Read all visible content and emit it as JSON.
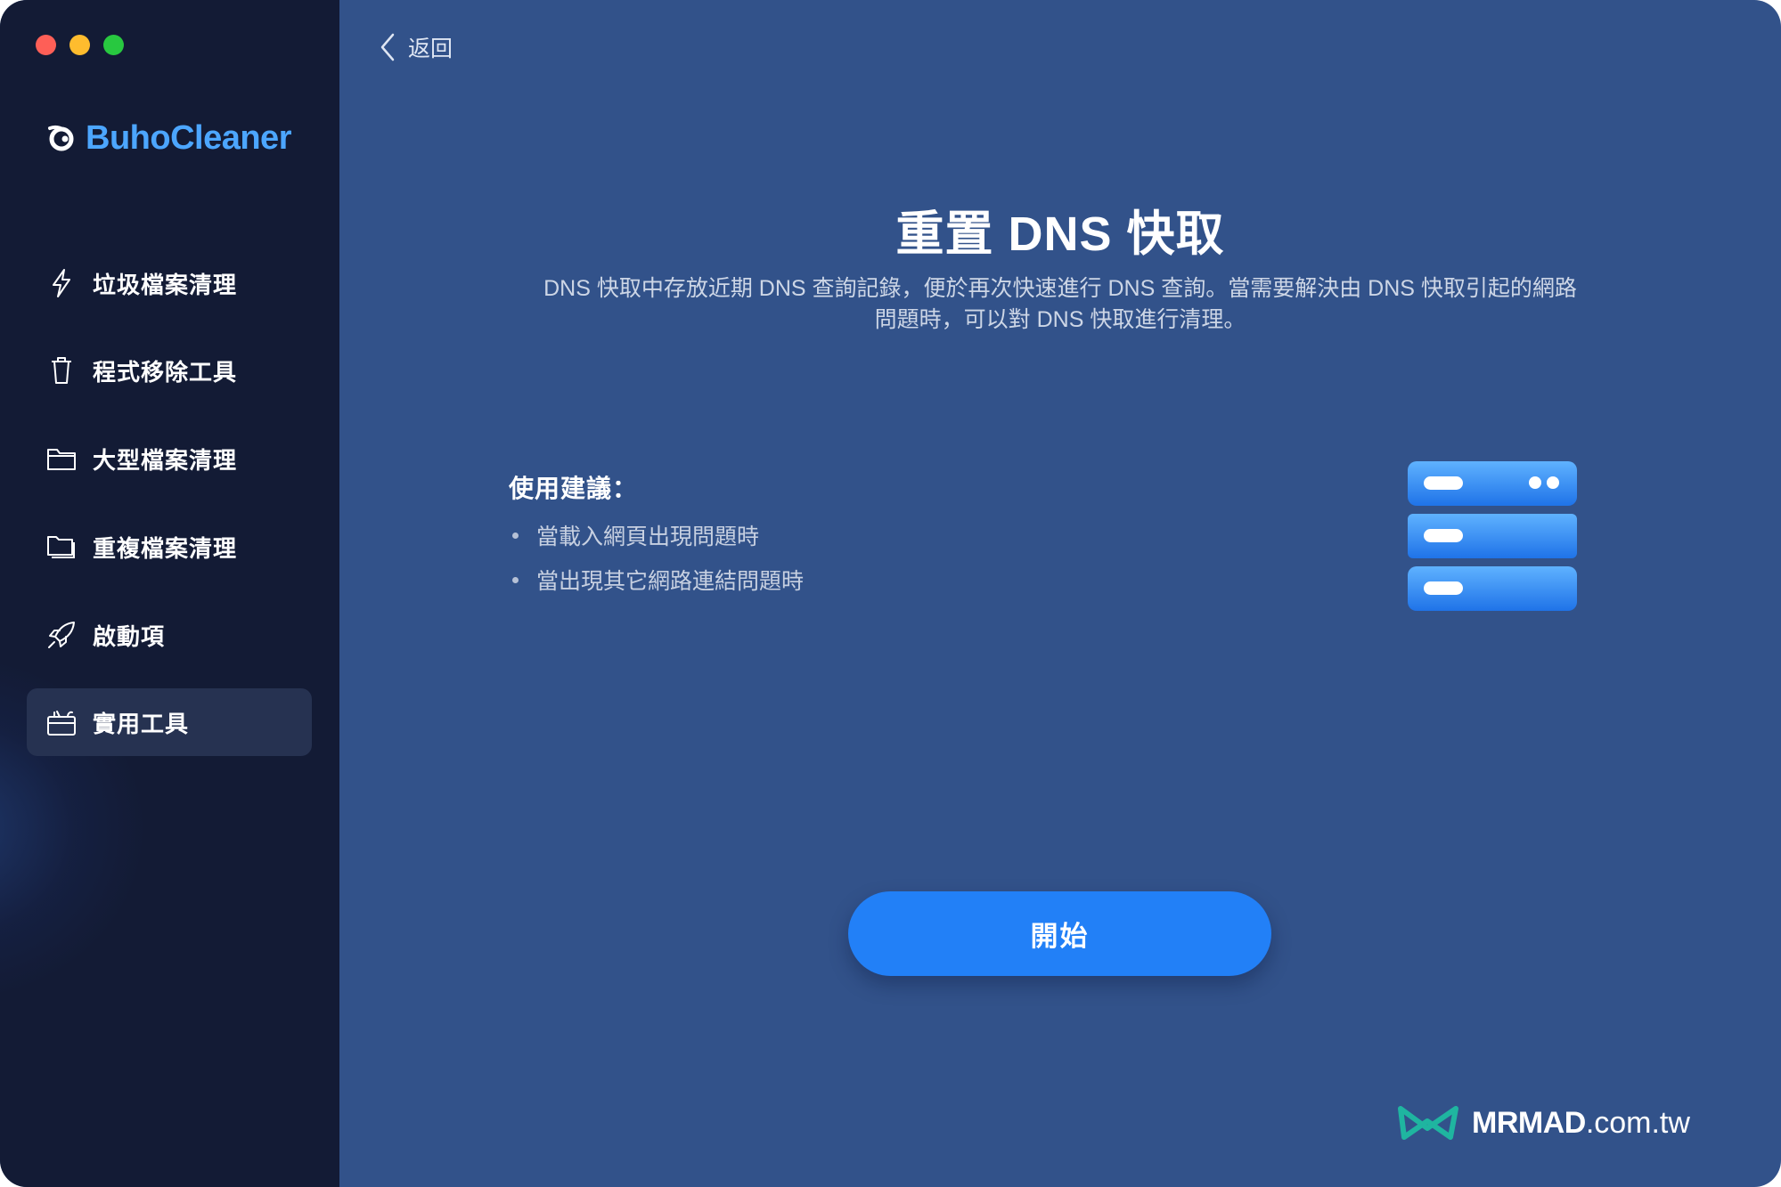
{
  "window": {
    "controls": [
      "close",
      "minimize",
      "maximize"
    ]
  },
  "sidebar": {
    "app_name": "BuhoCleaner",
    "items": [
      {
        "label": "垃圾檔案清理",
        "icon": "bolt-icon"
      },
      {
        "label": "程式移除工具",
        "icon": "trash-icon"
      },
      {
        "label": "大型檔案清理",
        "icon": "folder-icon"
      },
      {
        "label": "重複檔案清理",
        "icon": "duplicate-folder-icon"
      },
      {
        "label": "啟動項",
        "icon": "rocket-icon"
      },
      {
        "label": "實用工具",
        "icon": "toolbox-icon",
        "active": true
      }
    ]
  },
  "main": {
    "back_label": "返回",
    "title": "重置 DNS 快取",
    "description_line1": "DNS 快取中存放近期 DNS 查詢記錄，便於再次快速進行 DNS 查詢。當需要解決由 DNS 快取引起的網路",
    "description_line2": "問題時，可以對 DNS 快取進行清理。",
    "tips_heading": "使用建議：",
    "tips": [
      "當載入網頁出現問題時",
      "當出現其它網路連結問題時"
    ],
    "illustration_icon": "dns-server-icon",
    "start_button_label": "開始"
  },
  "watermark": {
    "brand": "MRMAD",
    "domain": ".com.tw"
  },
  "colors": {
    "sidebar_bg": "#131b35",
    "main_bg": "#32528a",
    "accent": "#2280f7",
    "logo_text": "#4ca6ff"
  }
}
